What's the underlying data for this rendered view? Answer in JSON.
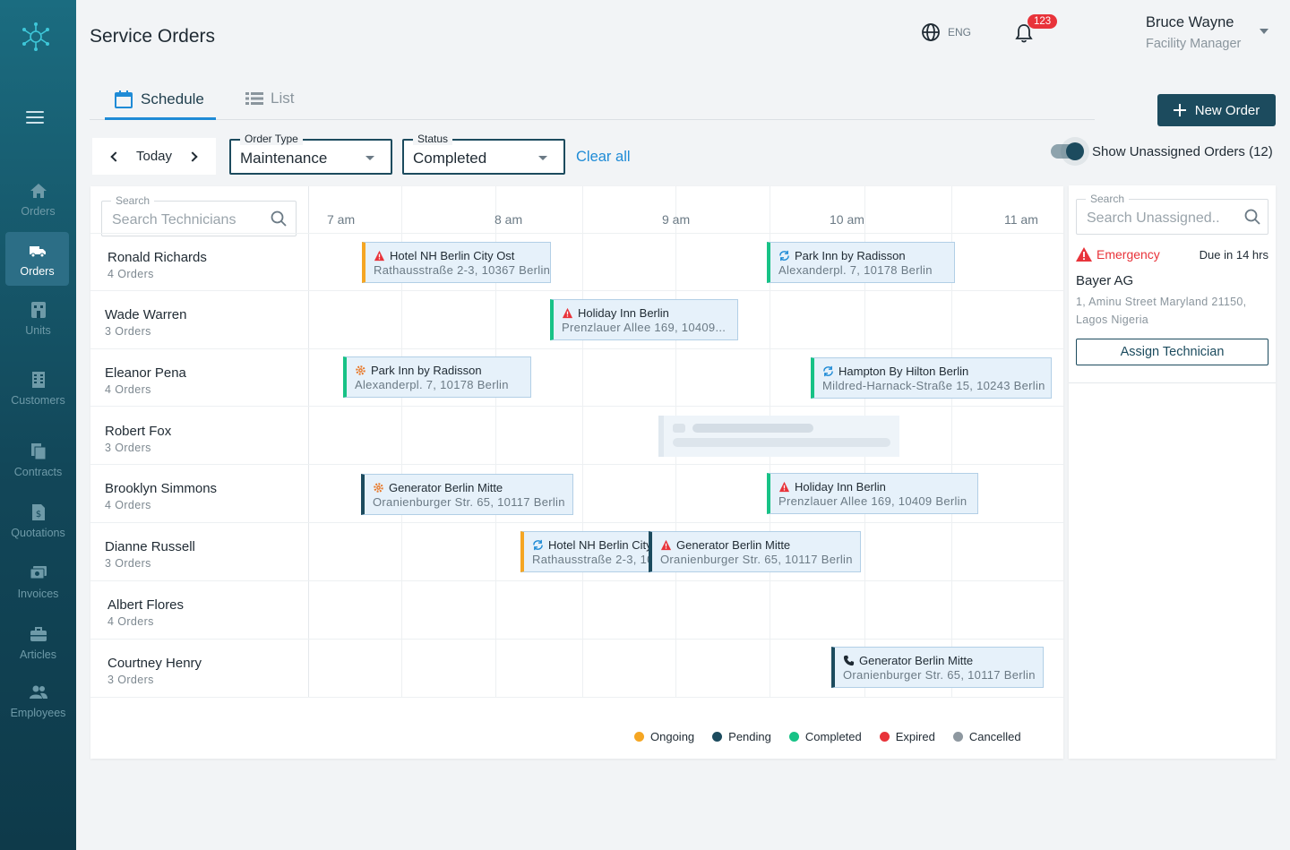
{
  "app": {
    "title": "Service Orders"
  },
  "colors": {
    "sidebar": "#124759",
    "accent": "#1f8bd6",
    "primary": "#1c4b5e",
    "ongoing": "#f5a623",
    "pending": "#1c4b5e",
    "completed": "#17c286",
    "expired": "#e8333a",
    "cancelled": "#8e98a0"
  },
  "sidebar": {
    "items": [
      {
        "label": "Orders",
        "icon": "home-icon"
      },
      {
        "label": "Orders",
        "icon": "truck-icon"
      },
      {
        "label": "Units",
        "icon": "units-icon"
      },
      {
        "label": "Customers",
        "icon": "building-icon"
      },
      {
        "label": "Contracts",
        "icon": "documents-icon"
      },
      {
        "label": "Quotations",
        "icon": "dollar-document-icon"
      },
      {
        "label": "Invoices",
        "icon": "invoice-icon"
      },
      {
        "label": "Articles",
        "icon": "toolbox-icon"
      },
      {
        "label": "Employees",
        "icon": "people-icon"
      }
    ]
  },
  "header": {
    "language": "ENG",
    "notifications": "123",
    "user": {
      "name": "Bruce Wayne",
      "role": "Facility Manager"
    }
  },
  "tabs": [
    {
      "label": "Schedule"
    },
    {
      "label": "List"
    }
  ],
  "actions": {
    "new_order": "New Order",
    "clear_all": "Clear all"
  },
  "filters": {
    "date": "Today",
    "order_type": {
      "label": "Order Type",
      "value": "Maintenance"
    },
    "status": {
      "label": "Status",
      "value": "Completed"
    },
    "show_unassigned": "Show Unassigned Orders (12)"
  },
  "schedule": {
    "search": {
      "label": "Search",
      "placeholder": "Search Technicians"
    },
    "times": [
      "7 am",
      "8 am",
      "9 am",
      "10 am",
      "11 am"
    ],
    "technicians": [
      {
        "name": "Ronald Richards",
        "orders": "4 Orders"
      },
      {
        "name": "Wade Warren",
        "orders": "3 Orders"
      },
      {
        "name": "Eleanor Pena",
        "orders": "4 Orders"
      },
      {
        "name": "Robert Fox",
        "orders": "3 Orders"
      },
      {
        "name": "Brooklyn Simmons",
        "orders": "4 Orders"
      },
      {
        "name": "Dianne Russell",
        "orders": "3 Orders"
      },
      {
        "name": "Albert Flores",
        "orders": "4 Orders"
      },
      {
        "name": "Courtney Henry",
        "orders": "3 Orders"
      }
    ],
    "orders": [
      {
        "title": "Hotel NH Berlin City Ost",
        "address": "Rathausstraße 2-3, 10367 Berlin",
        "icon": "warning-icon",
        "status": "ongoing"
      },
      {
        "title": "Park Inn by Radisson",
        "address": "Alexanderpl. 7, 10178 Berlin",
        "icon": "refresh-icon",
        "status": "completed"
      },
      {
        "title": "Holiday Inn Berlin",
        "address": "Prenzlauer Allee 169, 10409...",
        "icon": "warning-icon",
        "status": "completed"
      },
      {
        "title": "Park Inn by Radisson",
        "address": "Alexanderpl. 7, 10178 Berlin",
        "icon": "gear-icon",
        "status": "completed"
      },
      {
        "title": "Hampton By Hilton Berlin",
        "address": "Mildred-Harnack-Straße 15, 10243 Berlin",
        "icon": "refresh-icon",
        "status": "completed"
      },
      {
        "title": "Generator Berlin Mitte",
        "address": "Oranienburger Str. 65, 10117 Berlin",
        "icon": "gear-icon",
        "status": "pending"
      },
      {
        "title": "Holiday Inn Berlin",
        "address": "Prenzlauer Allee 169, 10409 Berlin",
        "icon": "warning-icon",
        "status": "completed"
      },
      {
        "title": "Hotel NH Berlin City",
        "address": "Rathausstraße 2-3, 10",
        "icon": "refresh-icon",
        "status": "ongoing"
      },
      {
        "title": "Generator Berlin Mitte",
        "address": "Oranienburger Str. 65, 10117 Berlin",
        "icon": "warning-icon",
        "status": "pending"
      },
      {
        "title": "Generator Berlin Mitte",
        "address": "Oranienburger Str. 65, 10117 Berlin",
        "icon": "phone-icon",
        "status": "pending"
      }
    ],
    "legend": [
      "Ongoing",
      "Pending",
      "Completed",
      "Expired",
      "Cancelled"
    ]
  },
  "unassigned": {
    "search": {
      "label": "Search",
      "placeholder": "Search Unassigned.."
    },
    "item": {
      "priority": "Emergency",
      "due": "Due in 14 hrs",
      "company": "Bayer AG",
      "address": "1, Aminu Street Maryland 21150, Lagos Nigeria",
      "button": "Assign Technician"
    }
  }
}
